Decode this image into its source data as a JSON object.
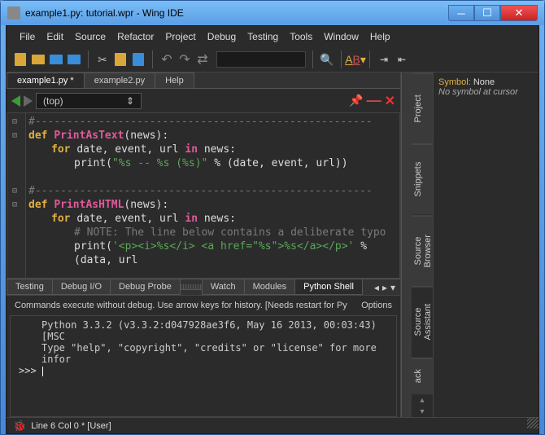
{
  "title": "example1.py: tutorial.wpr - Wing IDE",
  "menu": [
    "File",
    "Edit",
    "Source",
    "Refactor",
    "Project",
    "Debug",
    "Testing",
    "Tools",
    "Window",
    "Help"
  ],
  "editor_tabs": [
    "example1.py *",
    "example2.py",
    "Help"
  ],
  "editor_tab_active": 0,
  "scope": "(top)",
  "code_lines": [
    {
      "t": "cmt",
      "v": "#-----------------------------------------------------"
    },
    {
      "t": "def",
      "kw": "def",
      "name": "PrintAsText",
      "args": "(news):"
    },
    {
      "t": "for",
      "kw": "for",
      "vars": "date, event, url",
      "kin": "in",
      "iter": "news:"
    },
    {
      "t": "print",
      "fn": "print",
      "str": "\"%s -- %s (%s)\"",
      "rest": " % (date, event, url))"
    },
    {
      "t": "blank"
    },
    {
      "t": "cmt",
      "v": "#-----------------------------------------------------"
    },
    {
      "t": "def",
      "kw": "def",
      "name": "PrintAsHTML",
      "args": "(news):"
    },
    {
      "t": "for",
      "kw": "for",
      "vars": "date, event, url",
      "kin": "in",
      "iter": "news:"
    },
    {
      "t": "note",
      "v": "# NOTE: The line below contains a deliberate typo"
    },
    {
      "t": "print",
      "fn": "print",
      "str": "'<p><i>%s</i> <a href=\"%s\">%s</a></p>'",
      "rest": " % (data, url"
    }
  ],
  "bottom_tabs": [
    "Testing",
    "Debug I/O",
    "Debug Probe",
    "",
    "Watch",
    "Modules",
    "Python Shell"
  ],
  "bottom_tab_active": 6,
  "shell_info": "Commands execute without debug.  Use arrow keys for history. [Needs restart for Py",
  "shell_options": "Options",
  "shell_line1": "Python 3.3.2 (v3.3.2:d047928ae3f6, May 16 2013, 00:03:43) [MSC",
  "shell_line2": "Type \"help\", \"copyright\", \"credits\" or \"license\" for more infor",
  "shell_prompt": ">>>",
  "side_tabs_right": [
    "Project",
    "Snippets",
    "Source Browser",
    "Source Assistant",
    "ack"
  ],
  "symbol_label": "Symbol:",
  "symbol_value": "None",
  "symbol_sub": "No symbol at cursor",
  "status": "Line 6 Col 0 * [User]"
}
